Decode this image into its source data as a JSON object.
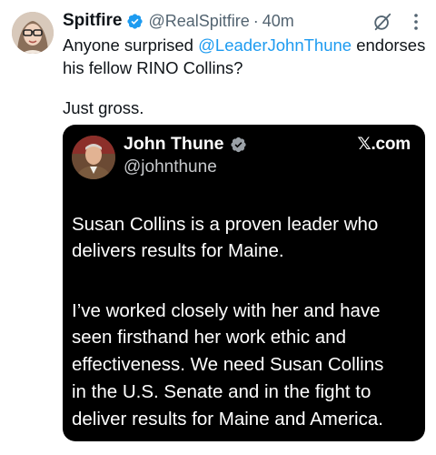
{
  "tweet": {
    "display_name": "Spitfire",
    "handle": "@RealSpitfire",
    "separator": "·",
    "time": "40m",
    "text_before_mention": "Anyone surprised ",
    "mention": "@LeaderJohnThune",
    "text_after_mention": " endorses",
    "text_line2": "his fellow RINO Collins?",
    "text_line3": "Just gross.",
    "icons": [
      "verified-badge-icon",
      "grok-icon",
      "more-options-icon"
    ],
    "accent_color": "#1d9bf0"
  },
  "embedded": {
    "name": "John Thune",
    "handle": "@johnthune",
    "source": "𝕏.com",
    "lines": [
      "Susan Collins is a proven leader who",
      "delivers results for Maine.",
      "I’ve worked closely with her and have",
      "seen firsthand her work ethic and",
      "effectiveness. We need Susan Collins",
      "in the U.S. Senate and in the fight to",
      "deliver results for Maine and America."
    ],
    "background_color": "#000000"
  }
}
